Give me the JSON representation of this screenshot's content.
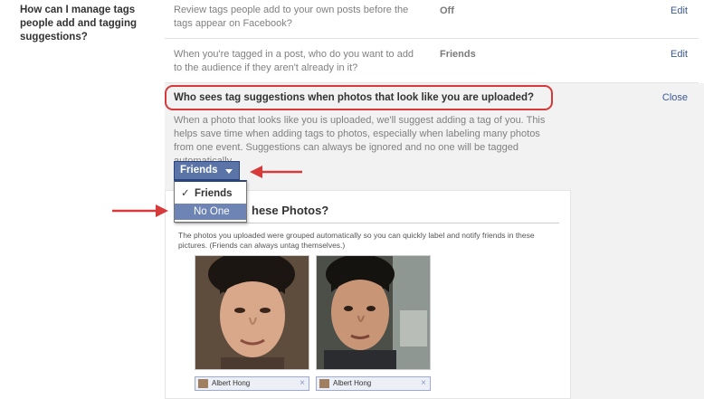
{
  "sidebar": {
    "heading": "How can I manage tags people add and tagging suggestions?"
  },
  "settings": [
    {
      "description": "Review tags people add to your own posts before the tags appear on Facebook?",
      "value": "Off",
      "action": "Edit"
    },
    {
      "description": "When you're tagged in a post, who do you want to add to the audience if they aren't already in it?",
      "value": "Friends",
      "action": "Edit"
    }
  ],
  "expanded": {
    "question": "Who sees tag suggestions when photos that look like you are uploaded?",
    "close_label": "Close",
    "explanation": "When a photo that looks like you is uploaded, we'll suggest adding a tag of you. This helps save time when adding tags to photos, especially when labeling many photos from one event. Suggestions can always be ignored and no one will be tagged automatically.",
    "dropdown": {
      "selected": "Friends",
      "options": [
        "Friends",
        "No One"
      ],
      "checkmark": "✓"
    },
    "preview": {
      "title": "hese Photos?",
      "text": "The photos you uploaded were grouped automatically so you can quickly label and notify friends in these pictures. (Friends can always untag themselves.)",
      "tags": [
        "Albert Hong",
        "Albert Hong"
      ],
      "remove_glyph": "×"
    }
  },
  "colors": {
    "link": "#3b5998",
    "dropdown_bg": "#5b74a8",
    "highlight": "#6d84b4",
    "annotation_red": "#d63a3a"
  }
}
